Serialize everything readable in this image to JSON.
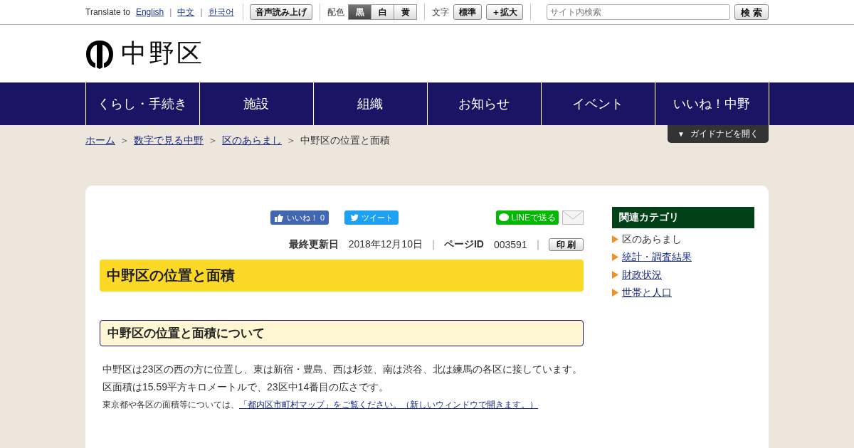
{
  "utility_bar": {
    "translate_label": "Translate to",
    "languages": [
      "English",
      "中文",
      "한국어"
    ],
    "language_separator": "|",
    "read_aloud": "音声読み上げ",
    "color_label": "配色",
    "color_schemes": [
      {
        "label": "黒",
        "selected": true
      },
      {
        "label": "白",
        "selected": false
      },
      {
        "label": "黄",
        "selected": false
      }
    ],
    "text_label": "文字",
    "text_sizes": [
      "標準",
      "＋拡大"
    ],
    "search": {
      "placeholder": "サイト内検索",
      "button": "検 索"
    }
  },
  "header": {
    "logo_text": "中野区"
  },
  "nav": [
    "くらし・手続き",
    "施設",
    "組織",
    "お知らせ",
    "イベント",
    "いいね！中野"
  ],
  "guide_navi": {
    "arrow": "▼",
    "label": "ガイドナビを開く"
  },
  "breadcrumb": {
    "links": [
      "ホーム",
      "数字で見る中野",
      "区のあらまし"
    ],
    "separator": "＞",
    "current": "中野区の位置と面積"
  },
  "share": {
    "like": "いいね！",
    "like_count": "0",
    "tweet": "ツイート",
    "line": "LINEで送る"
  },
  "meta": {
    "updated_label": "最終更新日",
    "updated": "2018年12月10日",
    "page_id_label": "ページID",
    "page_id": "003591",
    "separator": "｜",
    "print": "印 刷"
  },
  "page_title": "中野区の位置と面積",
  "section_title": "中野区の位置と面積について",
  "paragraphs": [
    {
      "text": "中野区は23区の西の方に位置し、東は新宿・豊島、西は杉並、南は渋谷、北は練馬の各区に接しています。"
    },
    {
      "text": "区面積は15.59平方キロメートルで、23区中14番目の広さです。"
    },
    {
      "text": "東京都や各区の面積等については、",
      "link": "「都内区市町村マップ」をご覧ください。（新しいウィンドウで開きます。）"
    }
  ],
  "sidebar": {
    "title": "関連カテゴリ",
    "items": [
      {
        "label": "区のあらまし",
        "selected": true
      },
      {
        "label": "統計・調査結果",
        "selected": false
      },
      {
        "label": "財政状況",
        "selected": false
      },
      {
        "label": "世帯と人口",
        "selected": false
      }
    ]
  }
}
